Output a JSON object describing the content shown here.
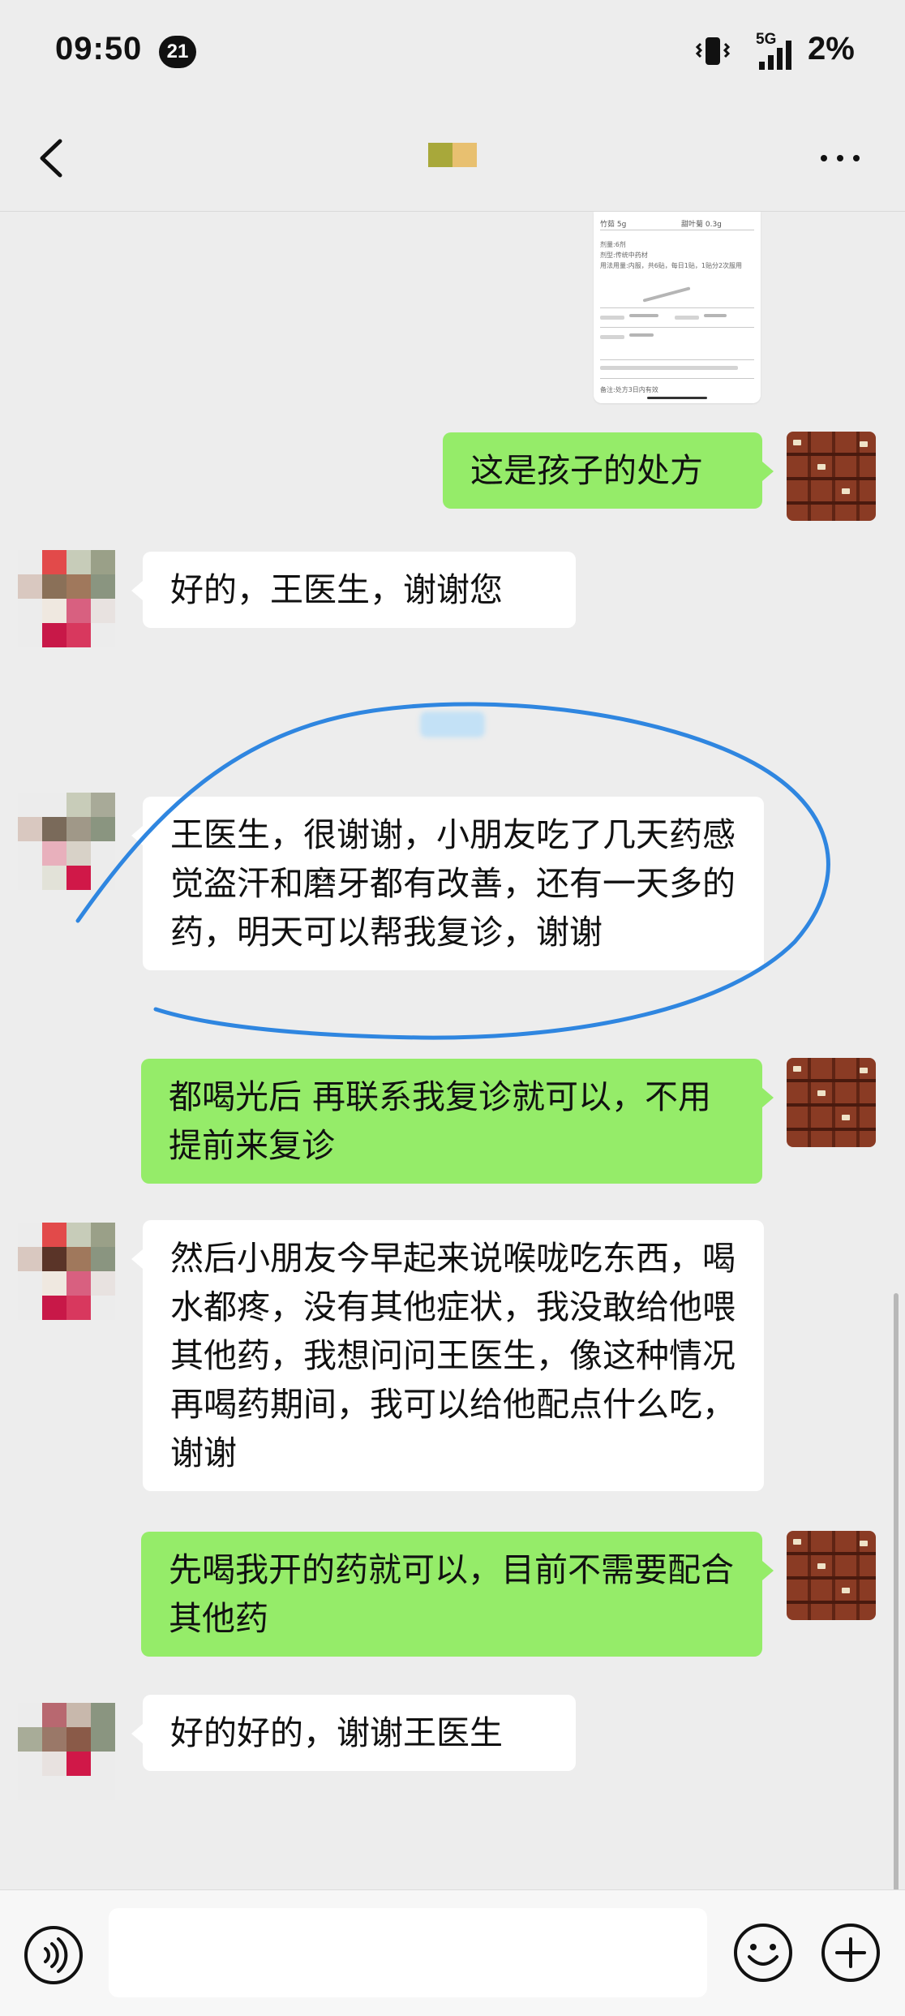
{
  "status_bar": {
    "time": "09:50",
    "notification_count": "21",
    "network": "5G",
    "battery": "2%"
  },
  "header": {
    "back_icon": "chevron-left-icon",
    "more_icon": "ellipsis-icon",
    "title_mosaic_colors": [
      "#a8a83a",
      "#e8c070"
    ]
  },
  "messages": [
    {
      "side": "out",
      "type": "image",
      "description_name": "prescription-image"
    },
    {
      "side": "out",
      "text": "这是孩子的处方"
    },
    {
      "side": "in",
      "text": "好的，王医生，谢谢您"
    },
    {
      "side": "in",
      "text": "王医生，很谢谢，小朋友吃了几天药感觉盗汗和磨牙都有改善，还有一天多的药，明天可以帮我复诊，谢谢"
    },
    {
      "side": "out",
      "text": "都喝光后 再联系我复诊就可以，不用提前来复诊"
    },
    {
      "side": "in",
      "text": "然后小朋友今早起来说喉咙吃东西，喝水都疼，没有其他症状，我没敢给他喂其他药，我想问问王医生，像这种情况再喝药期间，我可以给他配点什么吃，谢谢"
    },
    {
      "side": "out",
      "text": "先喝我开的药就可以，目前不需要配合其他药"
    },
    {
      "side": "in",
      "text": "好的好的，谢谢王医生"
    }
  ],
  "prescription": {
    "line1_left": "竹茹 5g",
    "line1_right": "甜叶菊 0.3g",
    "notes": [
      "剂量:6剂",
      "剂型:传统中药材",
      "用法用量:内服，共6贴，每日1贴，1贴分2次服用"
    ],
    "footer": "备注:处方3日内有效"
  },
  "input_bar": {
    "voice_icon": "voice-icon",
    "emoji_icon": "emoji-smile-icon",
    "plus_icon": "plus-circle-icon",
    "placeholder": ""
  },
  "colors": {
    "background": "#ededed",
    "outgoing_bubble": "#95ec69",
    "incoming_bubble": "#ffffff",
    "annotation_stroke": "#2f86e0"
  }
}
